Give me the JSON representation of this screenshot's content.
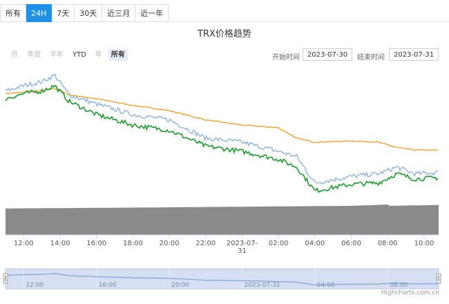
{
  "tabs": [
    {
      "label": "所有"
    },
    {
      "label": "24H"
    },
    {
      "label": "7天"
    },
    {
      "label": "30天"
    },
    {
      "label": "近三月"
    },
    {
      "label": "近一年"
    }
  ],
  "active_tab": "24H",
  "range_selector": {
    "buttons": [
      "月",
      "季度",
      "半年",
      "YTD",
      "年",
      "所有"
    ],
    "enabled": [
      "YTD",
      "所有"
    ],
    "selected": "所有",
    "start_label": "开始时间",
    "start_value": "2023-07-30",
    "end_label": "结束时间",
    "end_value": "2023-07-31"
  },
  "navigator_labels": [
    "12:00",
    "16:00",
    "20:00",
    "2023-07-31",
    "04:00",
    "08:00"
  ],
  "credit": "Highcharts.com.cn",
  "colors": {
    "orange": "#f0a030",
    "blue": "#8fb2e0",
    "green": "#1a9a2a",
    "volume": "#8a8a8a",
    "navigator_bg": "#cfdaf0",
    "accent": "#1e90e6"
  },
  "chart_data": {
    "type": "line",
    "title": "TRX价格趋势",
    "x_ticks": [
      "12:00",
      "14:00",
      "16:00",
      "18:00",
      "20:00",
      "22:00",
      "2023-07-31",
      "02:00",
      "04:00",
      "06:00",
      "08:00",
      "10:00"
    ],
    "x_range": [
      "2023-07-30 11:00",
      "2023-07-31 10:50"
    ],
    "y_axis_labels": "none",
    "gridlines": false,
    "series": [
      {
        "color": "#f0a030",
        "values": [
          [
            11.0,
            0.0816
          ],
          [
            12.0,
            0.0817
          ],
          [
            13.0,
            0.0818
          ],
          [
            13.7,
            0.082
          ],
          [
            14.5,
            0.0815
          ],
          [
            16.0,
            0.0812
          ],
          [
            18.0,
            0.0807
          ],
          [
            20.0,
            0.0803
          ],
          [
            22.0,
            0.0796
          ],
          [
            24.0,
            0.0792
          ],
          [
            26.0,
            0.079
          ],
          [
            27.0,
            0.0782
          ],
          [
            28.0,
            0.0779
          ],
          [
            30.0,
            0.078
          ],
          [
            31.5,
            0.0779
          ],
          [
            32.5,
            0.0775
          ],
          [
            33.5,
            0.0773
          ],
          [
            34.8,
            0.0773
          ]
        ]
      },
      {
        "color": "#8fb2e0",
        "values": [
          [
            11.0,
            0.0818
          ],
          [
            12.0,
            0.0822
          ],
          [
            13.0,
            0.0825
          ],
          [
            13.7,
            0.083
          ],
          [
            14.5,
            0.0815
          ],
          [
            16.0,
            0.0808
          ],
          [
            18.0,
            0.08
          ],
          [
            20.0,
            0.0796
          ],
          [
            22.0,
            0.0782
          ],
          [
            24.0,
            0.0779
          ],
          [
            26.0,
            0.0772
          ],
          [
            27.0,
            0.0768
          ],
          [
            28.0,
            0.0748
          ],
          [
            30.0,
            0.0753
          ],
          [
            31.5,
            0.0755
          ],
          [
            32.5,
            0.076
          ],
          [
            33.5,
            0.0755
          ],
          [
            34.8,
            0.0756
          ]
        ]
      },
      {
        "color": "#1a9a2a",
        "values": [
          [
            11.0,
            0.0812
          ],
          [
            12.0,
            0.0816
          ],
          [
            13.0,
            0.0818
          ],
          [
            13.7,
            0.0822
          ],
          [
            14.5,
            0.081
          ],
          [
            16.0,
            0.08
          ],
          [
            18.0,
            0.0792
          ],
          [
            20.0,
            0.0788
          ],
          [
            22.0,
            0.0776
          ],
          [
            24.0,
            0.0772
          ],
          [
            26.0,
            0.0766
          ],
          [
            27.0,
            0.076
          ],
          [
            28.0,
            0.0742
          ],
          [
            30.0,
            0.0747
          ],
          [
            31.5,
            0.0748
          ],
          [
            32.5,
            0.0755
          ],
          [
            33.5,
            0.0751
          ],
          [
            34.8,
            0.0752
          ]
        ]
      }
    ],
    "volume": {
      "color": "#8a8a8a",
      "values": [
        [
          11.0,
          300
        ],
        [
          18.0,
          310
        ],
        [
          24.0,
          320
        ],
        [
          30.0,
          330
        ],
        [
          32.0,
          345
        ],
        [
          32.1,
          330
        ],
        [
          34.8,
          340
        ]
      ]
    }
  }
}
